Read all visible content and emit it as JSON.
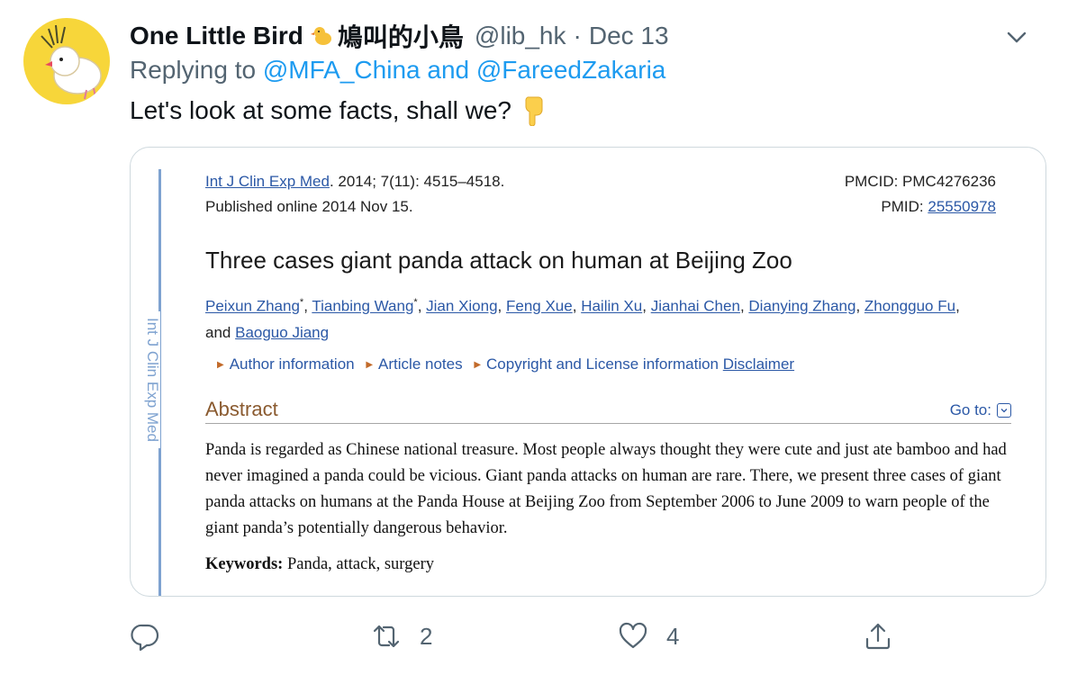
{
  "tweet": {
    "author_name": "One Little Bird",
    "author_cjk": "鳩叫的小鳥",
    "handle": "@lib_hk",
    "separator": "·",
    "date": "Dec 13",
    "replying_prefix": "Replying to ",
    "replying_to": "@MFA_China and @FareedZakaria",
    "text": "Let's look at some facts, shall we?"
  },
  "card": {
    "sidebar_label": "Int J Clin Exp Med",
    "journal_link": "Int J Clin Exp Med",
    "citation": ". 2014; 7(11): 4515–4518.",
    "published": "Published online 2014 Nov 15.",
    "pmcid": "PMCID: PMC4276236",
    "pmid_label": "PMID: ",
    "pmid_value": "25550978",
    "title": "Three cases giant panda attack on human at Beijing Zoo",
    "authors": [
      "Peixun Zhang",
      "Tianbing Wang",
      "Jian Xiong",
      "Feng Xue",
      "Hailin Xu",
      "Jianhai Chen",
      "Dianying Zhang",
      "Zhongguo Fu",
      "Baoguo Jiang"
    ],
    "and_text": "and",
    "info_links": [
      "Author information",
      "Article notes",
      "Copyright and License information"
    ],
    "disclaimer": "Disclaimer",
    "abstract_heading": "Abstract",
    "goto_label": "Go to:",
    "abstract_text": "Panda is regarded as Chinese national treasure. Most people always thought they were cute and just ate bamboo and had never imagined a panda could be vicious. Giant panda attacks on human are rare. There, we present three cases of giant panda attacks on humans at the Panda House at Beijing Zoo from September 2006 to June 2009 to warn people of the giant panda’s potentially dangerous behavior.",
    "keywords_label": "Keywords:",
    "keywords": "Panda, attack, surgery"
  },
  "actions": {
    "reply_icon": "reply-icon",
    "retweet_icon": "retweet-icon",
    "retweet_count": "2",
    "like_icon": "heart-icon",
    "like_count": "4",
    "share_icon": "share-icon"
  },
  "colors": {
    "link_blue": "#1d9bf0",
    "muted": "#536471",
    "pmc_link": "#2b58a6",
    "avatar_bg": "#f7d63a"
  }
}
